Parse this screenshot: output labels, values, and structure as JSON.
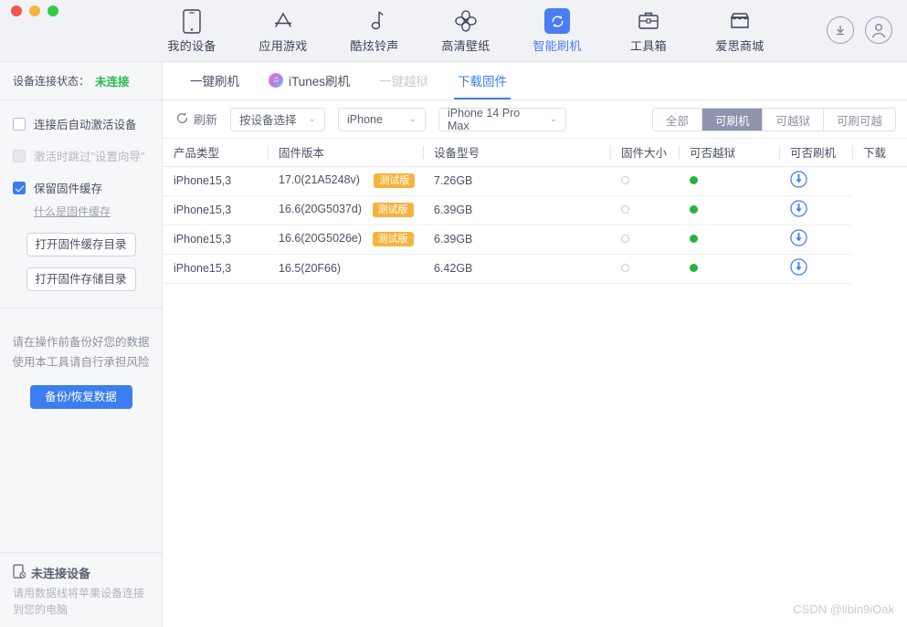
{
  "window": {
    "traffic_lights": [
      "close",
      "minimize",
      "maximize"
    ]
  },
  "topnav": {
    "items": [
      {
        "label": "我的设备",
        "icon": "phone-icon",
        "active": false
      },
      {
        "label": "应用游戏",
        "icon": "appstore-icon",
        "active": false
      },
      {
        "label": "酷炫铃声",
        "icon": "music-note-icon",
        "active": false
      },
      {
        "label": "高清壁纸",
        "icon": "flower-icon",
        "active": false
      },
      {
        "label": "智能刷机",
        "icon": "refresh-sync-icon",
        "active": true
      },
      {
        "label": "工具箱",
        "icon": "toolbox-icon",
        "active": false
      },
      {
        "label": "爱思商城",
        "icon": "store-icon",
        "active": false
      }
    ],
    "right_buttons": [
      {
        "name": "download-button",
        "icon": "download-circle-icon"
      },
      {
        "name": "account-button",
        "icon": "user-circle-icon"
      }
    ],
    "accent_color": "#4a7df0"
  },
  "sidebar": {
    "status": {
      "label": "设备连接状态：",
      "value": "未连接",
      "value_color": "#25b84c"
    },
    "options": [
      {
        "label": "连接后自动激活设备",
        "checked": false,
        "disabled": false
      },
      {
        "label": "激活时跳过\"设置向导\"",
        "checked": false,
        "disabled": true
      },
      {
        "label": "保留固件缓存",
        "checked": true,
        "disabled": false
      }
    ],
    "help_link": "什么是固件缓存",
    "buttons": [
      {
        "label": "打开固件缓存目录"
      },
      {
        "label": "打开固件存储目录"
      }
    ],
    "warning_lines": [
      "请在操作前备份好您的数据",
      "使用本工具请自行承担风险"
    ],
    "primary_button": "备份/恢复数据",
    "bottom": {
      "title": "未连接设备",
      "icon": "device-disconnected-icon",
      "subtitle": "请用数据线将苹果设备连接到您的电脑"
    }
  },
  "main": {
    "tabs": [
      {
        "label": "一键刷机",
        "state": "normal",
        "icon": null
      },
      {
        "label": "iTunes刷机",
        "state": "normal",
        "icon": "itunes-icon"
      },
      {
        "label": "一键越狱",
        "state": "disabled",
        "icon": null
      },
      {
        "label": "下载固件",
        "state": "active",
        "icon": null
      }
    ],
    "toolbar": {
      "refresh_label": "刷新",
      "refresh_icon": "refresh-icon",
      "selects": [
        {
          "name": "select-by-device",
          "value": "按设备选择"
        },
        {
          "name": "select-product-line",
          "value": "iPhone"
        },
        {
          "name": "select-model",
          "value": "iPhone 14 Pro Max"
        }
      ],
      "segments": [
        {
          "label": "全部",
          "active": false
        },
        {
          "label": "可刷机",
          "active": true
        },
        {
          "label": "可越狱",
          "active": false
        },
        {
          "label": "可刷可越",
          "active": false
        }
      ]
    },
    "table": {
      "columns": [
        {
          "key": "product_type",
          "label": "产品类型"
        },
        {
          "key": "firmware_version",
          "label": "固件版本"
        },
        {
          "key": "device_model",
          "label": "设备型号"
        },
        {
          "key": "firmware_size",
          "label": "固件大小"
        },
        {
          "key": "jailbreakable",
          "label": "可否越狱"
        },
        {
          "key": "flashable",
          "label": "可否刷机"
        },
        {
          "key": "download",
          "label": "下载"
        }
      ],
      "rows": [
        {
          "product_type": "iPhone15,3",
          "firmware_version": "17.0(21A5248v)",
          "badge": "测试版",
          "device_model": "",
          "firmware_size": "7.26GB",
          "jailbreakable": "no",
          "flashable": "yes",
          "download": "download-circle-icon"
        },
        {
          "product_type": "iPhone15,3",
          "firmware_version": "16.6(20G5037d)",
          "badge": "测试版",
          "device_model": "",
          "firmware_size": "6.39GB",
          "jailbreakable": "no",
          "flashable": "yes",
          "download": "download-circle-icon"
        },
        {
          "product_type": "iPhone15,3",
          "firmware_version": "16.6(20G5026e)",
          "badge": "测试版",
          "device_model": "",
          "firmware_size": "6.39GB",
          "jailbreakable": "no",
          "flashable": "yes",
          "download": "download-circle-icon"
        },
        {
          "product_type": "iPhone15,3",
          "firmware_version": "16.5(20F66)",
          "badge": "",
          "device_model": "",
          "firmware_size": "6.42GB",
          "jailbreakable": "no",
          "flashable": "yes",
          "download": "download-circle-icon"
        }
      ]
    }
  },
  "watermark": "CSDN @libin9iOak"
}
